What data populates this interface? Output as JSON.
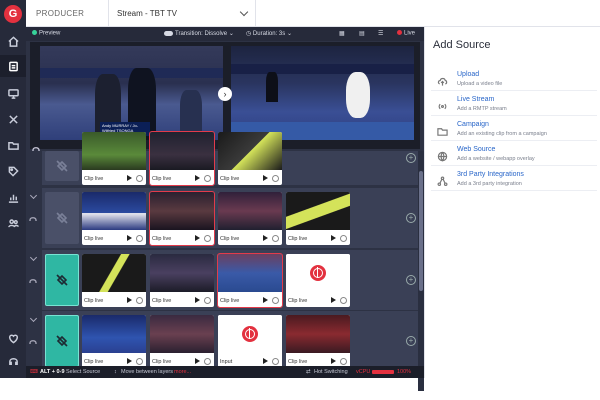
{
  "header": {
    "section": "PRODUCER",
    "stream": "Stream - TBT TV"
  },
  "toolbar": {
    "preview_label": "Preview",
    "transition": "Transition: Dissolve",
    "duration": "Duration: 3s",
    "live_label": "Live"
  },
  "preview": {
    "scene_a_caption": "Andy MURRAY / Jo-Wilfried TSONGA"
  },
  "layers": {
    "clip_live": "Clip live",
    "input": "Input"
  },
  "statusbar": {
    "shortcut": "ALT + 0-9",
    "shortcut_desc": "Select Source",
    "move": "Move between layers",
    "more": "more...",
    "hot_switching": "Hot Switching",
    "vcpu": "vCPU",
    "cpu_value": "100%"
  },
  "panel": {
    "title": "Add Source",
    "items": [
      {
        "title": "Upload",
        "sub": "Upload a video file",
        "icon": "upload-icon"
      },
      {
        "title": "Live Stream",
        "sub": "Add a RMTP stream",
        "icon": "broadcast-icon"
      },
      {
        "title": "Campaign",
        "sub": "Add an existing clip from a campaign",
        "icon": "folder-icon"
      },
      {
        "title": "Web Source",
        "sub": "Add a website / webapp overlay",
        "icon": "globe-icon"
      },
      {
        "title": "3rd Party Integrations",
        "sub": "Add a 3rd party integration",
        "icon": "integration-icon"
      }
    ]
  },
  "colors": {
    "accent_red": "#e3313f",
    "accent_teal": "#2fb7a3",
    "link_blue": "#2966c9",
    "rail_bg": "#262a3a"
  }
}
